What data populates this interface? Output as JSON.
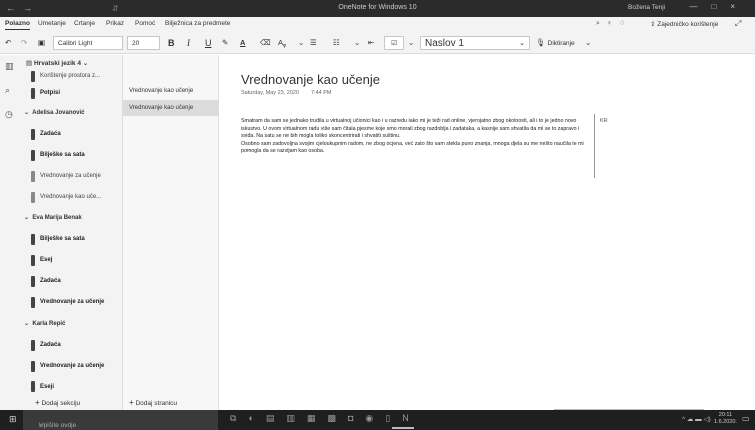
{
  "window": {
    "title": "OneNote for Windows 10",
    "user": "Božena Tenji",
    "back_icon": "←",
    "forward_icon": "→",
    "minimize": "—",
    "maximize": "□",
    "close": "×"
  },
  "menu": {
    "items": [
      "Polazno",
      "Umetanje",
      "Crtanje",
      "Prikaz",
      "Pomoć",
      "Bilježnica za predmete"
    ],
    "share_label": "Zajedničko korištenje"
  },
  "toolbar": {
    "font_name": "Calibri Light",
    "font_size": "20",
    "bold": "B",
    "italic": "I",
    "underline": "U",
    "style": "Naslov 1",
    "dictate": "Diktiranje"
  },
  "notebook": {
    "name": "Hrvatski jezik 4",
    "sections_top": [
      "Korištenje prostora z...",
      "Potpisi"
    ],
    "groups": [
      {
        "name": "Adelisa Jovanović",
        "sections": [
          "Zadaća",
          "Bilješke sa sata",
          "Vrednovanje za učenje",
          "Vrednovanje kao uče..."
        ]
      },
      {
        "name": "Eva Marija Benak",
        "sections": [
          "Bilješke sa sata",
          "Esej",
          "Zadaća",
          "Vrednovanje za učenje"
        ]
      },
      {
        "name": "Karla Repić",
        "sections": [
          "Zadaća",
          "Vrednovanje za učenje",
          "Eseji",
          "Bilješke sa sata",
          "Vrednovanje kao uče..."
        ]
      }
    ],
    "add_section": "Dodaj sekciju"
  },
  "pages": {
    "items": [
      "Vrednovanje kao učenje",
      "Vrednovanje kao učenje"
    ],
    "add_page": "Dodaj stranicu"
  },
  "page": {
    "title": "Vrednovanje kao učenje",
    "date": "Saturday, May 23, 2020",
    "time": "7:44 PM",
    "paragraphs": [
      "Smatram da sam se jednako trudila u virtualnoj učionici kao i u razredu iako mi je teži rad online, vjerojatno zbog okolnosti, ali i to je jedno novo iskustvo.  U ovom virtualnom radu više sam čitala  pjesme koje smo morali zbog razdoblja i zadataka, a kasnije sam shvatila da mi se to zapravo i sviđa. Na satu se ne bih mogla toliko skoncentrirati i shvatiti suštinu.",
      "Osobno sam zadovoljna svojim cjeloukupnim radom, ne zbog ocjena, već zato što sam stekla puno znanja, mnoga djela su me nešto naučila te mi pomogla da se razvijam kao osoba."
    ],
    "side_note": "KR"
  },
  "taskbar": {
    "search_placeholder": "Upišite ovdje za pretraživanje",
    "time": "20:11",
    "date": "1.6.2020."
  }
}
